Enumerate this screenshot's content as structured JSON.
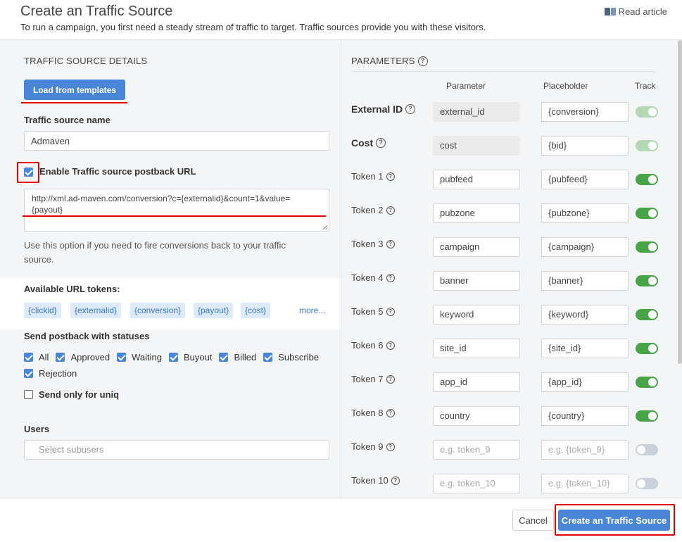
{
  "header": {
    "title": "Create an Traffic Source",
    "subtitle": "To run a campaign, you first need a steady stream of traffic to target. Traffic sources provide you with these visitors.",
    "read_article": "Read article"
  },
  "details": {
    "section_title": "TRAFFIC SOURCE DETAILS",
    "load_templates": "Load from templates",
    "name_label": "Traffic source name",
    "name_value": "Admaven",
    "postback_label": "Enable Traffic source postback URL",
    "postback_checked": true,
    "postback_url_line1": "http://xml.ad-maven.com/conversion?c={externalid}&count=1&value=",
    "postback_url_line2": "{payout}",
    "postback_help_line1": "Use this option if you need to fire conversions back to your traffic",
    "postback_help_line2": "source.",
    "tokens_label": "Available URL tokens:",
    "tokens": [
      "{clickid}",
      "{externalid}",
      "{conversion}",
      "{payout}",
      "{cost}"
    ],
    "tokens_more": "more...",
    "statuses_label": "Send postback with statuses",
    "statuses_row1": [
      "All",
      "Approved",
      "Waiting",
      "Buyout",
      "Billed",
      "Subscribe"
    ],
    "statuses_row2": [
      "Rejection"
    ],
    "uniq_label": "Send only for uniq",
    "users_label": "Users",
    "users_placeholder": "Select subusers"
  },
  "parameters": {
    "section_title": "PARAMETERS",
    "col_parameter": "Parameter",
    "col_placeholder": "Placeholder",
    "col_track": "Track",
    "rows": [
      {
        "label": "External ID",
        "param": "external_id",
        "placeholder": "{conversion}",
        "track": "on-disabled"
      },
      {
        "label": "Cost",
        "param": "cost",
        "placeholder": "{bid}",
        "track": "on-disabled"
      },
      {
        "label": "Token 1",
        "param": "pubfeed",
        "placeholder": "{pubfeed}",
        "track": "on"
      },
      {
        "label": "Token 2",
        "param": "pubzone",
        "placeholder": "{pubzone}",
        "track": "on"
      },
      {
        "label": "Token 3",
        "param": "campaign",
        "placeholder": "{campaign}",
        "track": "on"
      },
      {
        "label": "Token 4",
        "param": "banner",
        "placeholder": "{banner}",
        "track": "on"
      },
      {
        "label": "Token 5",
        "param": "keyword",
        "placeholder": "{keyword}",
        "track": "on"
      },
      {
        "label": "Token 6",
        "param": "site_id",
        "placeholder": "{site_id}",
        "track": "on"
      },
      {
        "label": "Token 7",
        "param": "app_id",
        "placeholder": "{app_id}",
        "track": "on"
      },
      {
        "label": "Token 8",
        "param": "country",
        "placeholder": "{country}",
        "track": "on"
      },
      {
        "label": "Token 9",
        "param_placeholder": "e.g. token_9",
        "placeholder_placeholder": "e.g. {token_9}",
        "track": "off"
      },
      {
        "label": "Token 10",
        "param_placeholder": "e.g. token_10",
        "placeholder_placeholder": "e.g. {token_10}",
        "track": "off"
      }
    ]
  },
  "footer": {
    "cancel": "Cancel",
    "create": "Create an Traffic Source"
  },
  "colors": {
    "primary": "#4a86d8",
    "annotation_red": "#e30000",
    "toggle_on": "#47a447"
  }
}
